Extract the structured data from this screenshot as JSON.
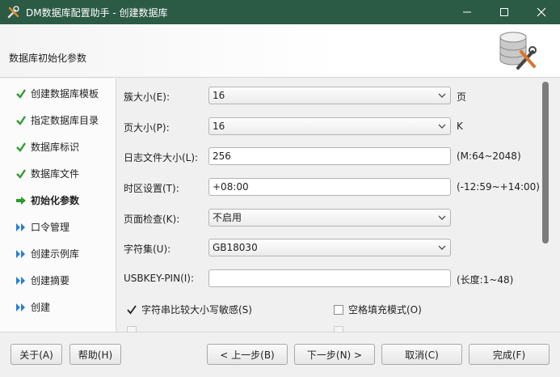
{
  "window": {
    "title": "DM数据库配置助手 - 创建数据库",
    "titlebar_color": "#2b5a45",
    "controls": [
      "minimize-icon",
      "maximize-icon",
      "close-icon"
    ]
  },
  "header": {
    "heading": "数据库初始化参数"
  },
  "sidebar": {
    "items": [
      {
        "label": "创建数据库模板",
        "icon": "check-icon",
        "state": "done"
      },
      {
        "label": "指定数据库目录",
        "icon": "check-icon",
        "state": "done"
      },
      {
        "label": "数据库标识",
        "icon": "check-icon",
        "state": "done"
      },
      {
        "label": "数据库文件",
        "icon": "check-icon",
        "state": "done"
      },
      {
        "label": "初始化参数",
        "icon": "arrow-right-icon",
        "state": "current"
      },
      {
        "label": "口令管理",
        "icon": "double-chevron-icon",
        "state": "pending"
      },
      {
        "label": "创建示例库",
        "icon": "double-chevron-icon",
        "state": "pending"
      },
      {
        "label": "创建摘要",
        "icon": "double-chevron-icon",
        "state": "pending"
      },
      {
        "label": "创建",
        "icon": "double-chevron-icon",
        "state": "pending"
      }
    ],
    "colors": {
      "done": "#2e9b2e",
      "current": "#2e9b2e",
      "pending": "#2a7fd4"
    }
  },
  "form": {
    "extent_size": {
      "label": "簇大小(E):",
      "value": "16",
      "suffix": "页"
    },
    "page_size": {
      "label": "页大小(P):",
      "value": "16",
      "suffix": "K"
    },
    "log_size": {
      "label": "日志文件大小(L):",
      "value": "256",
      "suffix": "(M:64~2048)"
    },
    "time_zone": {
      "label": "时区设置(T):",
      "value": "+08:00",
      "suffix": "(-12:59~+14:00)"
    },
    "page_check": {
      "label": "页面检查(K):",
      "value": "不启用"
    },
    "charset": {
      "label": "字符集(U):",
      "value": "GB18030"
    },
    "usbkey_pin": {
      "label": "USBKEY-PIN(I):",
      "value": "",
      "suffix": "(长度:1~48)"
    },
    "case_sensitive": {
      "label": "字符串比较大小写敏感(S)",
      "checked": true
    },
    "blank_pad": {
      "label": "空格填充模式(O)",
      "checked": false
    }
  },
  "footer": {
    "about": "关于(A)",
    "help": "帮助(H)",
    "prev": "< 上一步(B)",
    "next": "下一步(N) >",
    "cancel": "取消(C)",
    "finish": "完成(F)"
  }
}
